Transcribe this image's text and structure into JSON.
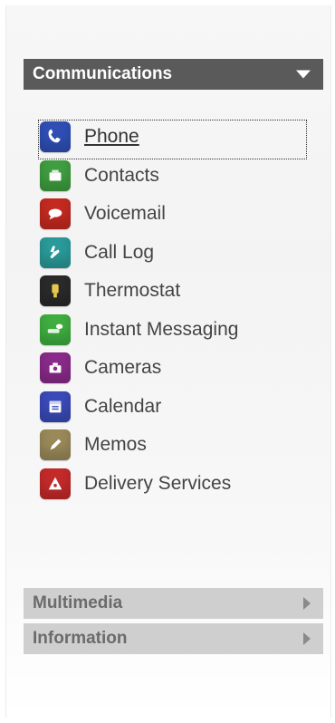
{
  "sections": {
    "communications": {
      "title": "Communications",
      "items": [
        {
          "label": "Phone",
          "icon": "phone-icon",
          "color": "#2f4fb6"
        },
        {
          "label": "Contacts",
          "icon": "contacts-icon",
          "color": "#3f9e3f"
        },
        {
          "label": "Voicemail",
          "icon": "voicemail-icon",
          "color": "#c42a20"
        },
        {
          "label": "Call Log",
          "icon": "call-log-icon",
          "color": "#2a9a9a"
        },
        {
          "label": "Thermostat",
          "icon": "thermostat-icon",
          "color": "#2a2a2a"
        },
        {
          "label": "Instant Messaging",
          "icon": "instant-messaging-icon",
          "color": "#3fae3f"
        },
        {
          "label": "Cameras",
          "icon": "cameras-icon",
          "color": "#8a2a8a"
        },
        {
          "label": "Calendar",
          "icon": "calendar-icon",
          "color": "#3a4ab8"
        },
        {
          "label": "Memos",
          "icon": "memos-icon",
          "color": "#9a8a5a"
        },
        {
          "label": "Delivery Services",
          "icon": "delivery-services-icon",
          "color": "#c42a2a"
        }
      ]
    },
    "multimedia": {
      "title": "Multimedia"
    },
    "information": {
      "title": "Information"
    }
  }
}
